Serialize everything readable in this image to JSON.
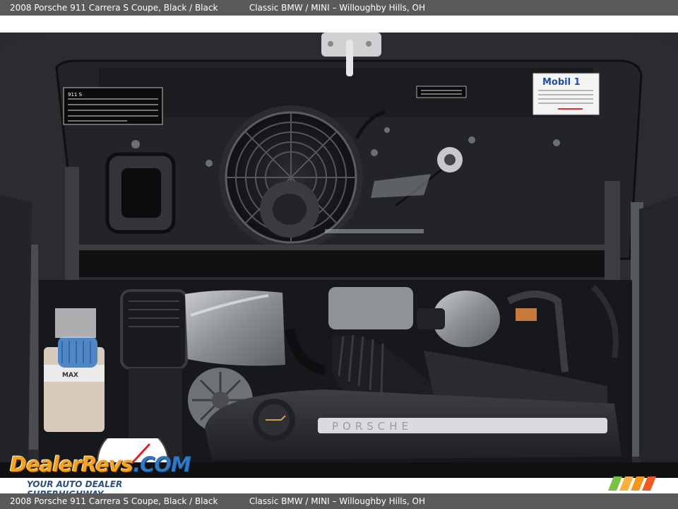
{
  "caption": {
    "vehicle": "2008 Porsche 911 Carrera S Coupe,  Black / Black",
    "dealer": "Classic BMW / MINI – Willoughby Hills, OH"
  },
  "photo": {
    "subject": "engine-bay",
    "labels": {
      "oil_brand": "Mobil 1",
      "engine_cover": "PORSCHE",
      "cap_label": "MAX",
      "emission_panel": "911 S"
    }
  },
  "watermark": {
    "logo_main": "DealerRevs",
    "logo_suffix": ".COM",
    "tagline": "YOUR AUTO DEALER SUPERHIGHWAY",
    "stripe_colors": [
      "#7ac143",
      "#f7941d",
      "#f15a24",
      "#fbb03b"
    ]
  }
}
